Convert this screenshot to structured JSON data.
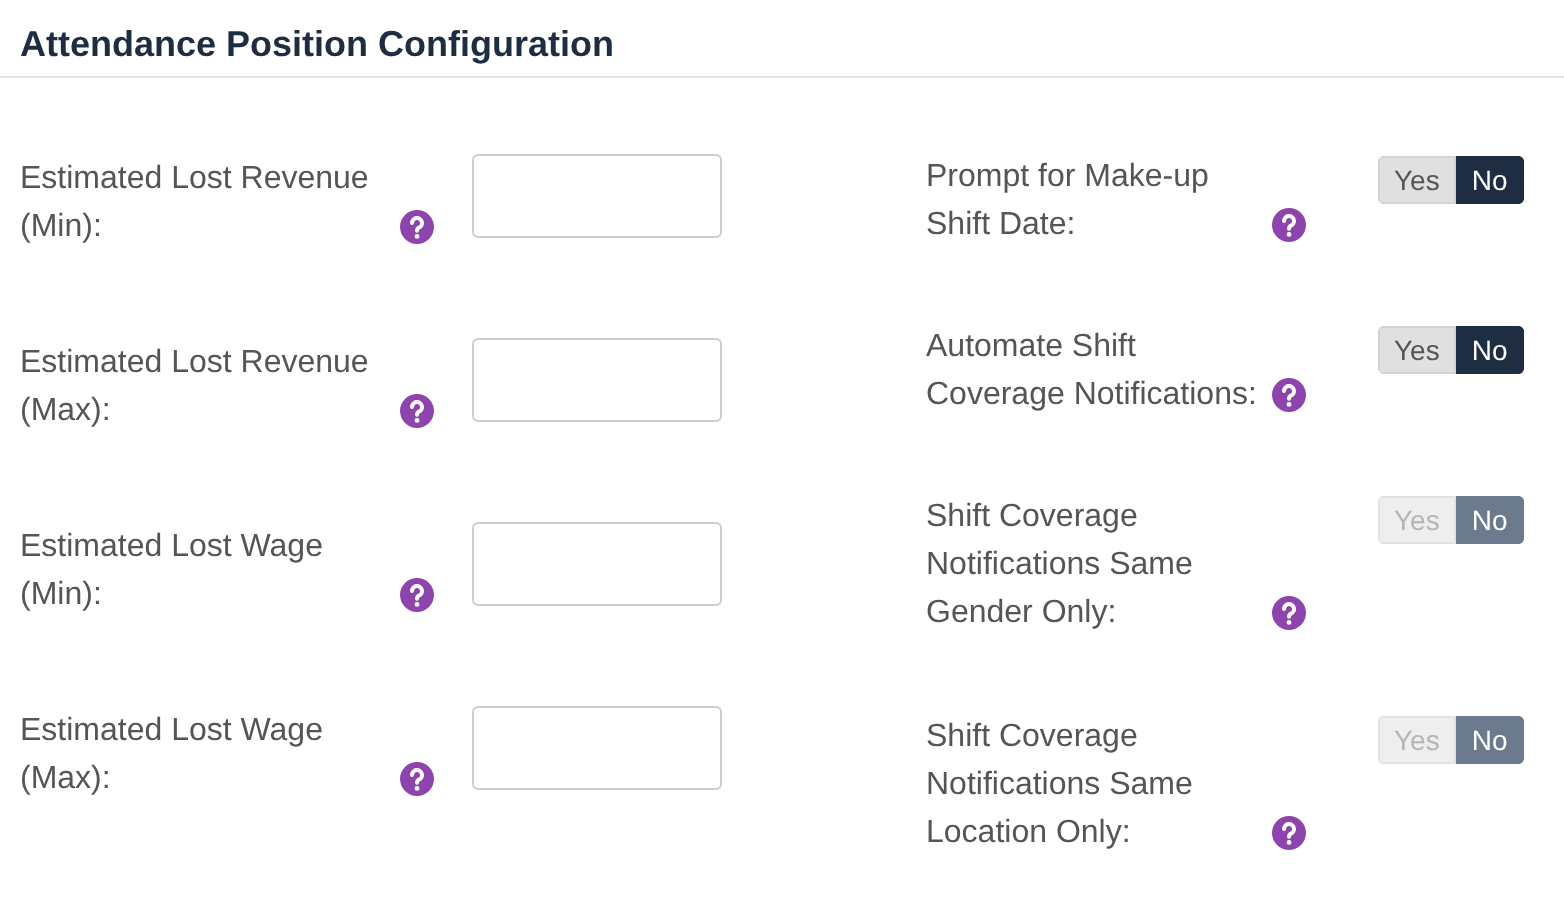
{
  "title": "Attendance Position Configuration",
  "fields": [
    {
      "label": "Estimated Lost Revenue (Min):"
    },
    {
      "label": "Estimated Lost Revenue (Max):"
    },
    {
      "label": "Estimated Lost Wage (Min):"
    },
    {
      "label": "Estimated Lost Wage (Max):"
    }
  ],
  "toggles": [
    {
      "label": "Prompt for Make-up Shift Date:",
      "disabled": false,
      "options": [
        {
          "label": "Yes",
          "selected": false
        },
        {
          "label": "No",
          "selected": true
        }
      ]
    },
    {
      "label": "Automate Shift Coverage Notifications:",
      "disabled": false,
      "options": [
        {
          "label": "Yes",
          "selected": false
        },
        {
          "label": "No",
          "selected": true
        }
      ]
    },
    {
      "label": "Shift Coverage Notifications Same Gender Only:",
      "disabled": true,
      "options": [
        {
          "label": "Yes",
          "selected": false
        },
        {
          "label": "No",
          "selected": true
        }
      ]
    },
    {
      "label": "Shift Coverage Notifications Same Location Only:",
      "disabled": true,
      "options": [
        {
          "label": "Yes",
          "selected": false
        },
        {
          "label": "No",
          "selected": true
        }
      ]
    }
  ]
}
